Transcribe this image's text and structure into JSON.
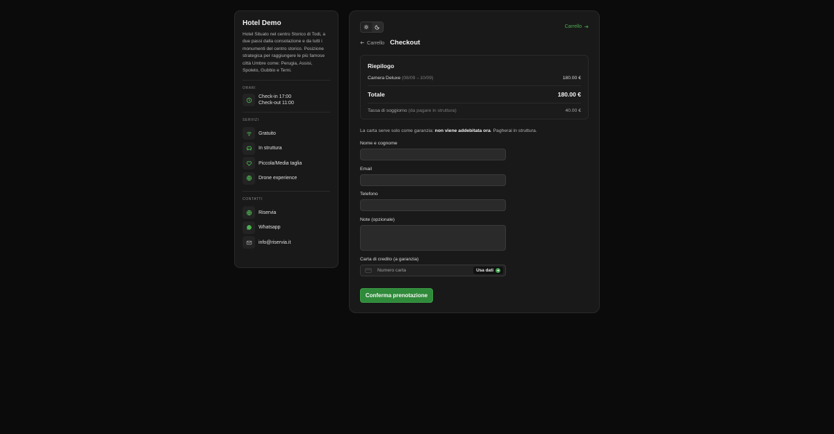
{
  "sidebar": {
    "hotel_name": "Hotel Demo",
    "description": "Hotel Situato nel centro Storico di Todi, a due passi dalla consolazione e da tutti i monumenti del centro storico. Posizione strategica per raggiungere le più famose città Umbre come: Perugia, Assisi, Spoleto, Gubbio e Terni.",
    "hours": {
      "label": "ORARI",
      "checkin": "Check-in 17:00",
      "checkout": "Check-out 11:00"
    },
    "services": {
      "label": "SERVIZI",
      "items": [
        {
          "label": "Gratuito",
          "icon": "wifi-icon"
        },
        {
          "label": "In struttura",
          "icon": "car-icon"
        },
        {
          "label": "Piccola/Media taglia",
          "icon": "heart-icon"
        },
        {
          "label": "Drone experience",
          "icon": "globe-icon"
        }
      ]
    },
    "contacts": {
      "label": "CONTATTI",
      "items": [
        {
          "label": "Riservia",
          "icon": "globe-icon"
        },
        {
          "label": "Whatsapp",
          "icon": "whatsapp-icon"
        },
        {
          "label": "info@riservia.it",
          "icon": "mail-icon"
        }
      ]
    }
  },
  "header": {
    "cart_link": "Carrello",
    "back_label": "Carrello",
    "title": "Checkout"
  },
  "summary": {
    "title": "Riepilogo",
    "room_label": "Camera Deluxe",
    "room_dates": "(08/09→10/09)",
    "room_price": "180.00 €",
    "total_label": "Totale",
    "total_value": "180.00 €",
    "tax_label": "Tassa di soggiorno",
    "tax_note": "(da pagare in struttura)",
    "tax_value": "40.00 €"
  },
  "notice": {
    "prefix": "La carta serve solo come garanzia: ",
    "bold": "non viene addebitata ora",
    "suffix": ". Pagherai in struttura."
  },
  "form": {
    "name_label": "Nome e cognome",
    "name_value": "",
    "email_label": "Email",
    "email_value": "",
    "phone_label": "Telefono",
    "phone_value": "",
    "notes_label": "Note (opzionale)",
    "notes_value": "",
    "card_label": "Carta di credito (a garanzia)",
    "card_placeholder": "Numero carta",
    "use_data_label": "Usa dati",
    "submit_label": "Conferma prenotazione"
  },
  "colors": {
    "accent": "#3fa34d",
    "background": "#0b0b0b",
    "panel": "#191919"
  }
}
